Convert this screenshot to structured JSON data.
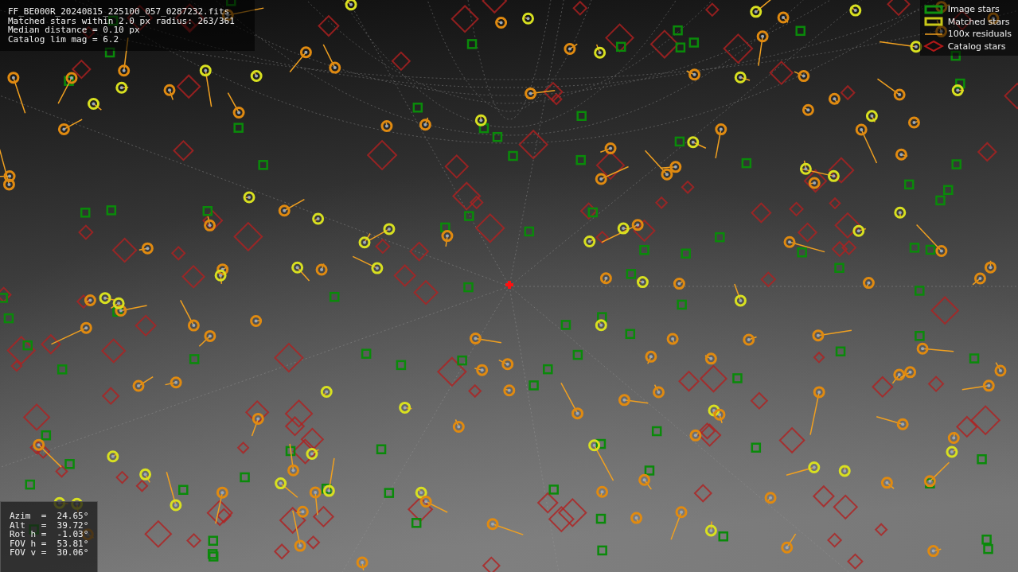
{
  "info": {
    "lines": [
      "FF_BE000R_20240815_225100_057_0287232.fits",
      "Matched stars within 2.0 px radius: 263/361",
      "Median distance = 0.10 px",
      "Catalog lim mag = 6.2"
    ]
  },
  "legend": [
    {
      "label": "Image stars"
    },
    {
      "kind": "matched",
      "label": "Matched stars"
    },
    {
      "kind": "residual",
      "label": "100x residuals"
    },
    {
      "kind": "catalog",
      "label": "Catalog stars"
    }
  ],
  "pointing": {
    "lines": [
      "Azim  =  24.65°",
      "Alt   =  39.72°",
      "Rot h =  -1.03°",
      "FOV h =  53.81°",
      "FOV v =  30.06°"
    ]
  }
}
